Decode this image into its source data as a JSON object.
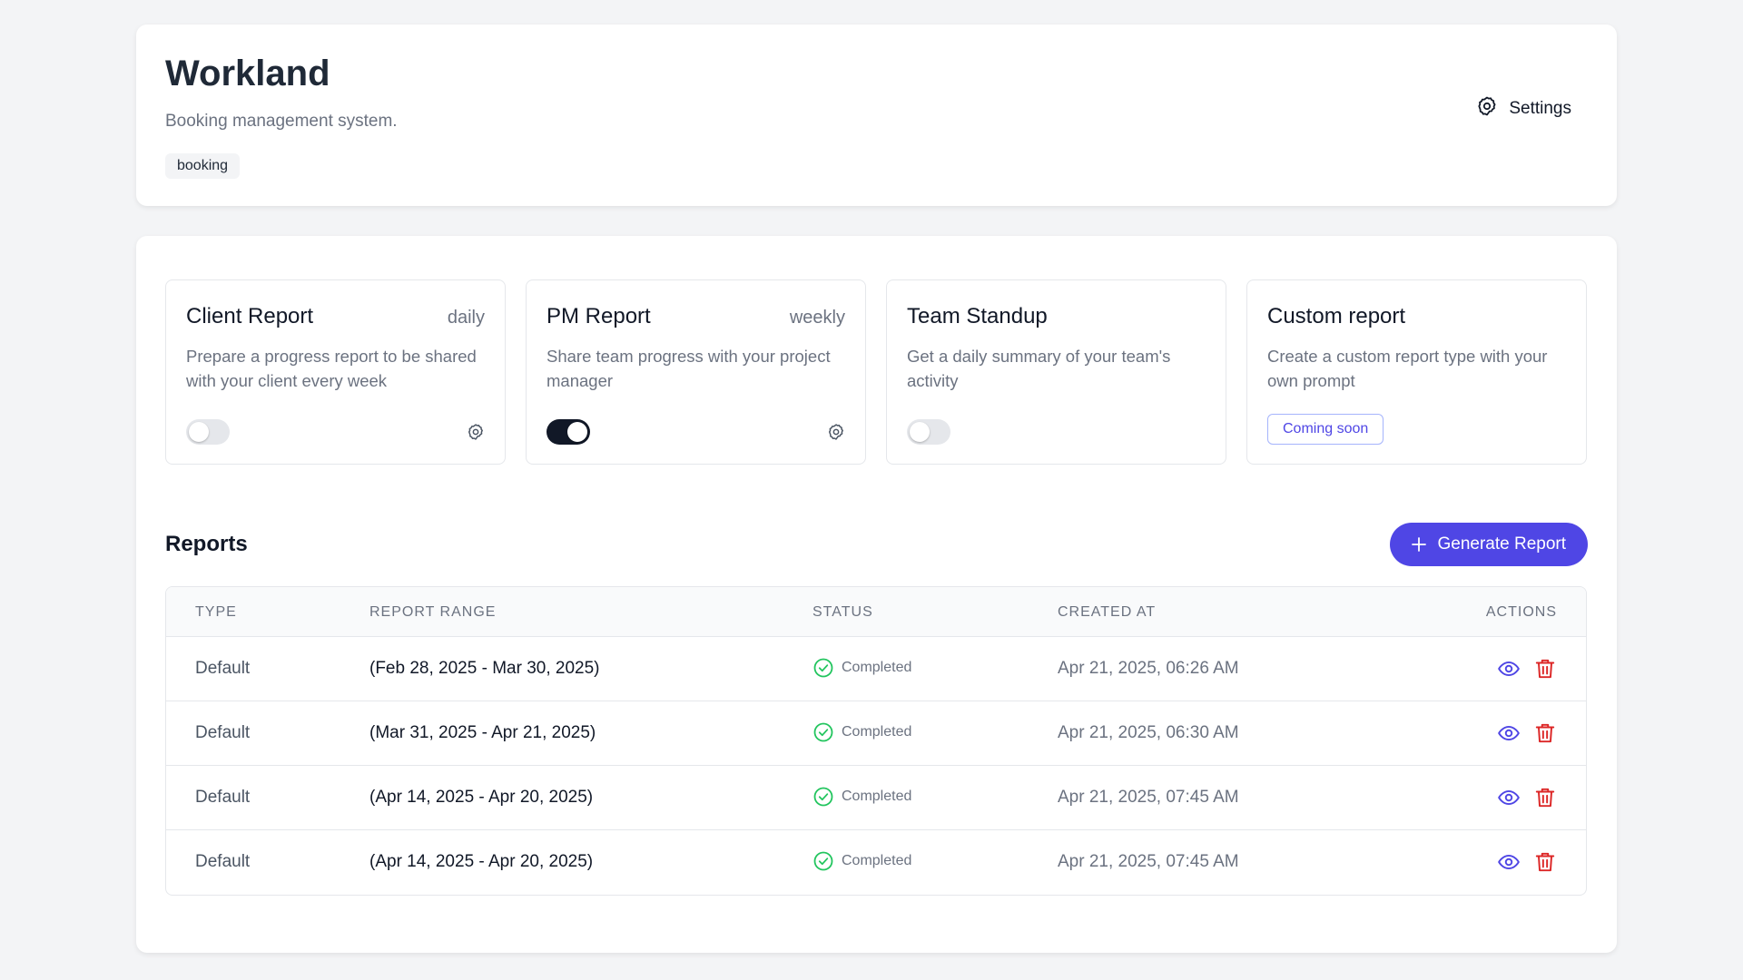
{
  "header": {
    "title": "Workland",
    "subtitle": "Booking management system.",
    "tag": "booking",
    "settings_label": "Settings"
  },
  "report_types": [
    {
      "name": "Client Report",
      "frequency": "daily",
      "description": "Prepare a progress report to be shared with your client every week",
      "enabled": false,
      "has_settings": true
    },
    {
      "name": "PM Report",
      "frequency": "weekly",
      "description": "Share team progress with your project manager",
      "enabled": true,
      "has_settings": true
    },
    {
      "name": "Team Standup",
      "frequency": "",
      "description": "Get a daily summary of your team's activity",
      "enabled": false,
      "has_settings": false
    },
    {
      "name": "Custom report",
      "frequency": "",
      "description": "Create a custom report type with your own prompt",
      "badge": "Coming soon"
    }
  ],
  "reports": {
    "title": "Reports",
    "generate_label": "Generate Report",
    "columns": [
      "TYPE",
      "REPORT RANGE",
      "STATUS",
      "CREATED AT",
      "ACTIONS"
    ],
    "rows": [
      {
        "type": "Default",
        "range": "(Feb 28, 2025 - Mar 30, 2025)",
        "status": "Completed",
        "created": "Apr 21, 2025, 06:26 AM"
      },
      {
        "type": "Default",
        "range": "(Mar 31, 2025 - Apr 21, 2025)",
        "status": "Completed",
        "created": "Apr 21, 2025, 06:30 AM"
      },
      {
        "type": "Default",
        "range": "(Apr 14, 2025 - Apr 20, 2025)",
        "status": "Completed",
        "created": "Apr 21, 2025, 07:45 AM"
      },
      {
        "type": "Default",
        "range": "(Apr 14, 2025 - Apr 20, 2025)",
        "status": "Completed",
        "created": "Apr 21, 2025, 07:45 AM"
      }
    ]
  },
  "colors": {
    "accent": "#4f46e5",
    "success": "#22c55e",
    "danger": "#dc2626",
    "toggle_on": "#111827"
  },
  "icons": {
    "settings": "gear-icon",
    "generate": "plus-icon",
    "status": "check-circle-icon",
    "view": "eye-icon",
    "delete": "trash-icon"
  }
}
